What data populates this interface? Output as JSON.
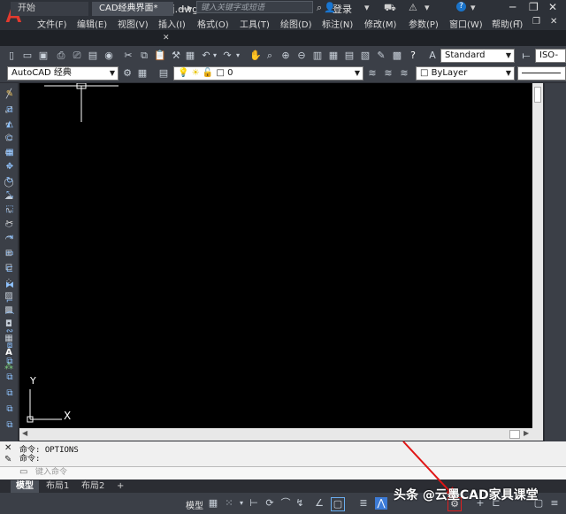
{
  "app": {
    "logo_letter": "A",
    "document_title": "CAD经典界面.dwg",
    "search_placeholder": "键入关键字或短语",
    "login_label": "登录",
    "accent_color": "#e33a2e"
  },
  "menubar": {
    "items": [
      "文件(F)",
      "编辑(E)",
      "视图(V)",
      "插入(I)",
      "格式(O)",
      "工具(T)",
      "绘图(D)",
      "标注(N)",
      "修改(M)",
      "参数(P)",
      "窗口(W)",
      "帮助(H)"
    ]
  },
  "tabs": {
    "start_label": "开始",
    "file_label": "CAD经典界面*",
    "add_label": "+"
  },
  "toolbar1": {
    "text_style": "Standard",
    "dim_style": "ISO-"
  },
  "toolbar2": {
    "workspace": "AutoCAD 经典",
    "layer": "0",
    "color": "ByLayer"
  },
  "canvas": {
    "ucs_y_label": "Y",
    "ucs_x_label": "X"
  },
  "command": {
    "history": [
      "命令: OPTIONS",
      "命令:"
    ],
    "input_placeholder": "键入命令"
  },
  "layout_tabs": {
    "model": "模型",
    "layout1": "布局1",
    "layout2": "布局2",
    "add": "+"
  },
  "statusbar": {
    "model_label": "模型"
  },
  "watermark": {
    "text": "头条 @云墨CAD家具课堂"
  }
}
